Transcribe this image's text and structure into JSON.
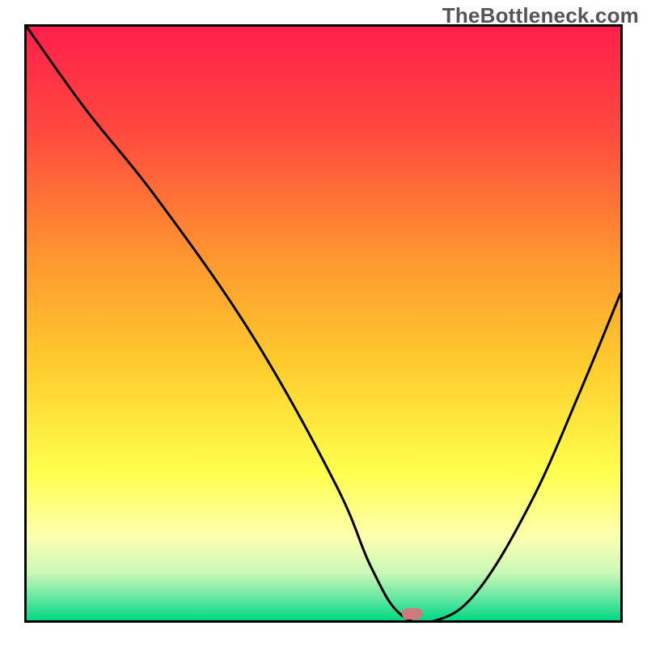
{
  "watermark": {
    "text": "TheBottleneck.com"
  },
  "chart_data": {
    "type": "line",
    "title": "",
    "xlabel": "",
    "ylabel": "",
    "xlim": [
      0,
      100
    ],
    "ylim": [
      0,
      100
    ],
    "grid": false,
    "legend": false,
    "background_gradient": {
      "stops": [
        {
          "offset": 0,
          "color": "#ff1f4b"
        },
        {
          "offset": 0.18,
          "color": "#ff4a3e"
        },
        {
          "offset": 0.4,
          "color": "#ff9a2f"
        },
        {
          "offset": 0.58,
          "color": "#ffcf2e"
        },
        {
          "offset": 0.75,
          "color": "#ffff4d"
        },
        {
          "offset": 0.86,
          "color": "#fdffb0"
        },
        {
          "offset": 0.92,
          "color": "#c9f8b7"
        },
        {
          "offset": 0.965,
          "color": "#5fe6a0"
        },
        {
          "offset": 1.0,
          "color": "#00d983"
        }
      ]
    },
    "series": [
      {
        "name": "bottleneck-curve",
        "x": [
          0,
          10,
          22,
          38,
          52,
          58,
          63,
          69,
          76,
          85,
          93,
          100
        ],
        "y": [
          100,
          86,
          71,
          48,
          23,
          9,
          1,
          0,
          5,
          20,
          38,
          55
        ]
      }
    ],
    "marker": {
      "x": 65,
      "y": 0.5
    },
    "marker_color": "#cf7a7e"
  }
}
